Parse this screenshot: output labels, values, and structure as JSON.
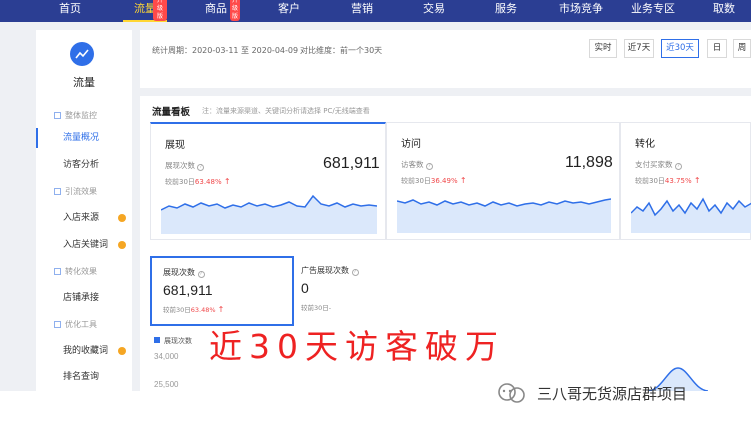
{
  "nav": {
    "items": [
      {
        "label": "首页",
        "badge": ""
      },
      {
        "label": "流量",
        "badge": "升级版"
      },
      {
        "label": "商品",
        "badge": "升级版"
      },
      {
        "label": "客户",
        "badge": ""
      },
      {
        "label": "营销",
        "badge": ""
      },
      {
        "label": "交易",
        "badge": ""
      },
      {
        "label": "服务",
        "badge": ""
      },
      {
        "label": "市场竞争",
        "badge": ""
      },
      {
        "label": "业务专区",
        "badge": ""
      },
      {
        "label": "取数",
        "badge": ""
      }
    ],
    "active_index": 1,
    "accent_color": "#ffd633",
    "bg_color": "#2b3e93"
  },
  "sidebar": {
    "icon": "chart-line-icon",
    "title": "流量",
    "rows": [
      {
        "type": "group",
        "label": "整体监控"
      },
      {
        "type": "link",
        "label": "流量概况",
        "active": true
      },
      {
        "type": "link",
        "label": "访客分析"
      },
      {
        "type": "group",
        "label": "引流效果"
      },
      {
        "type": "link",
        "label": "入店来源",
        "dot": true
      },
      {
        "type": "link",
        "label": "入店关键词",
        "dot": true
      },
      {
        "type": "group",
        "label": "转化效果"
      },
      {
        "type": "link",
        "label": "店铺承接"
      },
      {
        "type": "group",
        "label": "优化工具"
      },
      {
        "type": "link",
        "label": "我的收藏词",
        "dot": true
      },
      {
        "type": "link",
        "label": "排名查询"
      }
    ]
  },
  "filter": {
    "period_label": "统计周期：",
    "period_value": "2020-03-11 至 2020-04-09",
    "compare_label": "对比维度：",
    "compare_value": "前一个30天",
    "buttons": [
      "实时",
      "近7天",
      "近30天",
      "日",
      "周"
    ],
    "active_button": "近30天"
  },
  "panel": {
    "title": "流量看板",
    "note": "注：流量来源渠道、关键词分析请选择 PC/无线端查看",
    "cards": [
      {
        "title": "展现",
        "label": "展现次数",
        "value": "681,911",
        "compare_prefix": "较前30日",
        "compare_pct": "63.48%"
      },
      {
        "title": "访问",
        "label": "访客数",
        "value": "11,898",
        "compare_prefix": "较前30日",
        "compare_pct": "36.49%"
      },
      {
        "title": "转化",
        "label": "支付买家数",
        "value": "",
        "compare_prefix": "较前30日",
        "compare_pct": "43.75%"
      }
    ],
    "sub_cards": [
      {
        "label": "展现次数",
        "value": "681,911",
        "compare_prefix": "较前30日",
        "compare_pct": "63.48%"
      },
      {
        "label": "广告展现次数",
        "value": "0",
        "compare_prefix": "较前30日-",
        "compare_pct": ""
      }
    ],
    "legend": "展现次数",
    "y_ticks": [
      "34,000",
      "25,500"
    ]
  },
  "caption": "近30天访客破万",
  "watermark": {
    "text": "三八哥无货源店群项目",
    "icon": "wechat-official-account-icon"
  }
}
